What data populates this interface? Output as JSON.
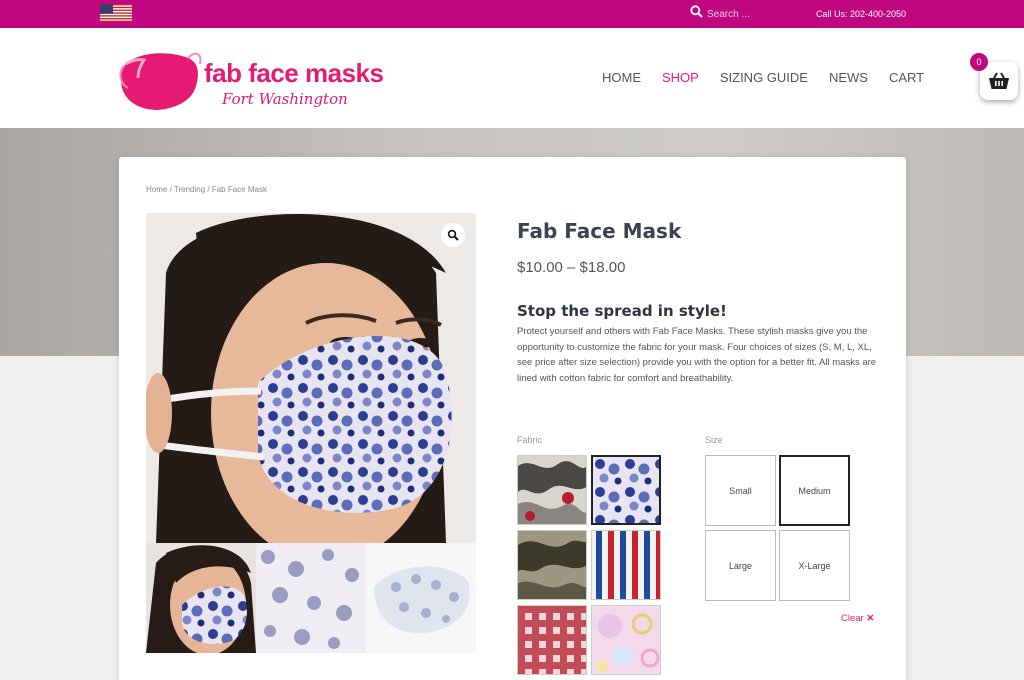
{
  "topbar": {
    "search_placeholder": "Search ...",
    "call_us": "Call Us: 202-400-2050"
  },
  "header": {
    "brand": "fab face masks",
    "tagline": "Fort Washington",
    "nav": [
      "HOME",
      "SHOP",
      "SIZING GUIDE",
      "NEWS",
      "CART"
    ],
    "active_nav": "SHOP",
    "cart_count": "0"
  },
  "breadcrumb": {
    "home": "Home",
    "sep1": " / ",
    "trending": "Trending",
    "sep2": " / ",
    "current": "Fab Face Mask"
  },
  "product": {
    "title": "Fab Face Mask",
    "price": "$10.00 – $18.00",
    "headline": "Stop the spread in style!",
    "description": "Protect yourself and others with Fab Face Masks. These stylish masks give you the opportunity to customize the fabric for your mask. Four choices of sizes (S, M, L, XL, see price after size selection) provide you with the option for a better fit. All masks are lined with cotton fabric for comfort and breathability."
  },
  "options": {
    "fabric_label": "Fabric",
    "size_label": "Size",
    "sizes": [
      "Small",
      "Medium",
      "Large",
      "X-Large"
    ],
    "selected_size": "Medium",
    "clear_label": "Clear"
  },
  "colors": {
    "brand": "#c1077f",
    "accent": "#e61a72",
    "title": "#3a4350"
  },
  "icons": {
    "flag": "us-flag-icon",
    "search": "search-icon",
    "cart": "basket-icon",
    "zoom": "magnifier-icon",
    "clear": "close-icon"
  }
}
